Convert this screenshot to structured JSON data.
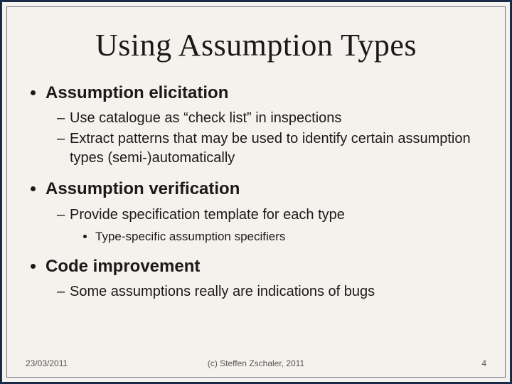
{
  "title": "Using Assumption Types",
  "sections": [
    {
      "heading": "Assumption elicitation",
      "items": [
        {
          "text": "Use catalogue as “check list” in inspections"
        },
        {
          "text": "Extract patterns that may be used to identify certain assumption types (semi-)automatically"
        }
      ]
    },
    {
      "heading": "Assumption verification",
      "items": [
        {
          "text": "Provide specification template for each type",
          "sub": [
            "Type-specific assumption specifiers"
          ]
        }
      ]
    },
    {
      "heading": "Code improvement",
      "items": [
        {
          "text": "Some assumptions really are indications of bugs"
        }
      ]
    }
  ],
  "footer": {
    "date": "23/03/2011",
    "copyright": "(c) Steffen Zschaler, 2011",
    "page": "4"
  }
}
